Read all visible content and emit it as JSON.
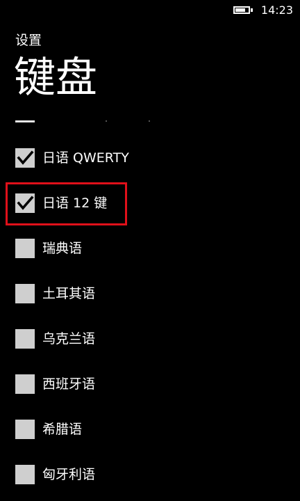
{
  "status_bar": {
    "time": "14:23",
    "battery_level_percent": 80
  },
  "header": {
    "breadcrumb": "设置",
    "title": "键盘"
  },
  "keyboard_options": [
    {
      "label": "日语 QWERTY",
      "checked": true
    },
    {
      "label": "日语 12 键",
      "checked": true,
      "highlighted": true
    },
    {
      "label": "瑞典语",
      "checked": false
    },
    {
      "label": "土耳其语",
      "checked": false
    },
    {
      "label": "乌克兰语",
      "checked": false
    },
    {
      "label": "西班牙语",
      "checked": false
    },
    {
      "label": "希腊语",
      "checked": false
    },
    {
      "label": "匈牙利语",
      "checked": false
    }
  ],
  "colors": {
    "background": "#000000",
    "text": "#ffffff",
    "checkbox": "#cfcfcf",
    "highlight": "#e0101a"
  }
}
